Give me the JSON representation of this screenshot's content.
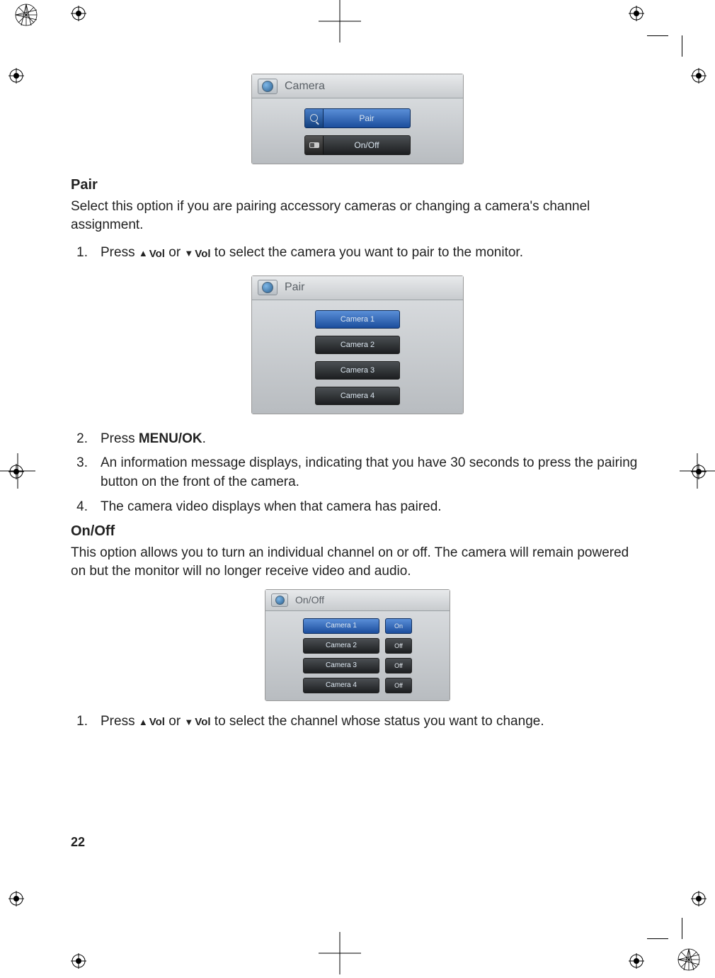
{
  "page_number": "22",
  "screenshot1": {
    "title": "Camera",
    "pair_label": "Pair",
    "onoff_label": "On/Off"
  },
  "pair_section": {
    "heading": "Pair",
    "intro": "Select this option if you are pairing accessory cameras or changing a camera's channel assignment.",
    "step1_num": "1.",
    "step1_prefix": "Press ",
    "vol_up": "Vol",
    "step1_or": " or ",
    "vol_down": "Vol",
    "step1_suffix": " to select the camera you want to pair to the monitor."
  },
  "screenshot2": {
    "title": "Pair",
    "camera1": "Camera  1",
    "camera2": "Camera  2",
    "camera3": "Camera  3",
    "camera4": "Camera  4"
  },
  "steps_after": {
    "s2num": "2.",
    "s2_prefix": "Press ",
    "s2_bold": "MENU/OK",
    "s2_suffix": ".",
    "s3num": "3.",
    "s3": "An information message displays, indicating that you have 30 seconds to press the pairing button on the front of the camera.",
    "s4num": "4.",
    "s4": "The camera video displays when that camera has paired."
  },
  "onoff_section": {
    "heading": "On/Off",
    "intro": "This option allows you to turn an individual channel on or off. The camera will remain powered on but the monitor will no longer receive video and audio."
  },
  "screenshot3": {
    "title": "On/Off",
    "rows": {
      "r1_cam": "Camera  1",
      "r1_state": "On",
      "r2_cam": "Camera  2",
      "r2_state": "Off",
      "r3_cam": "Camera  3",
      "r3_state": "Off",
      "r4_cam": "Camera  4",
      "r4_state": "Off"
    }
  },
  "final_step": {
    "num": "1.",
    "prefix": "Press ",
    "vol_up": "Vol",
    "or": " or ",
    "vol_down": "Vol",
    "suffix": " to select the channel whose status you want to change."
  }
}
